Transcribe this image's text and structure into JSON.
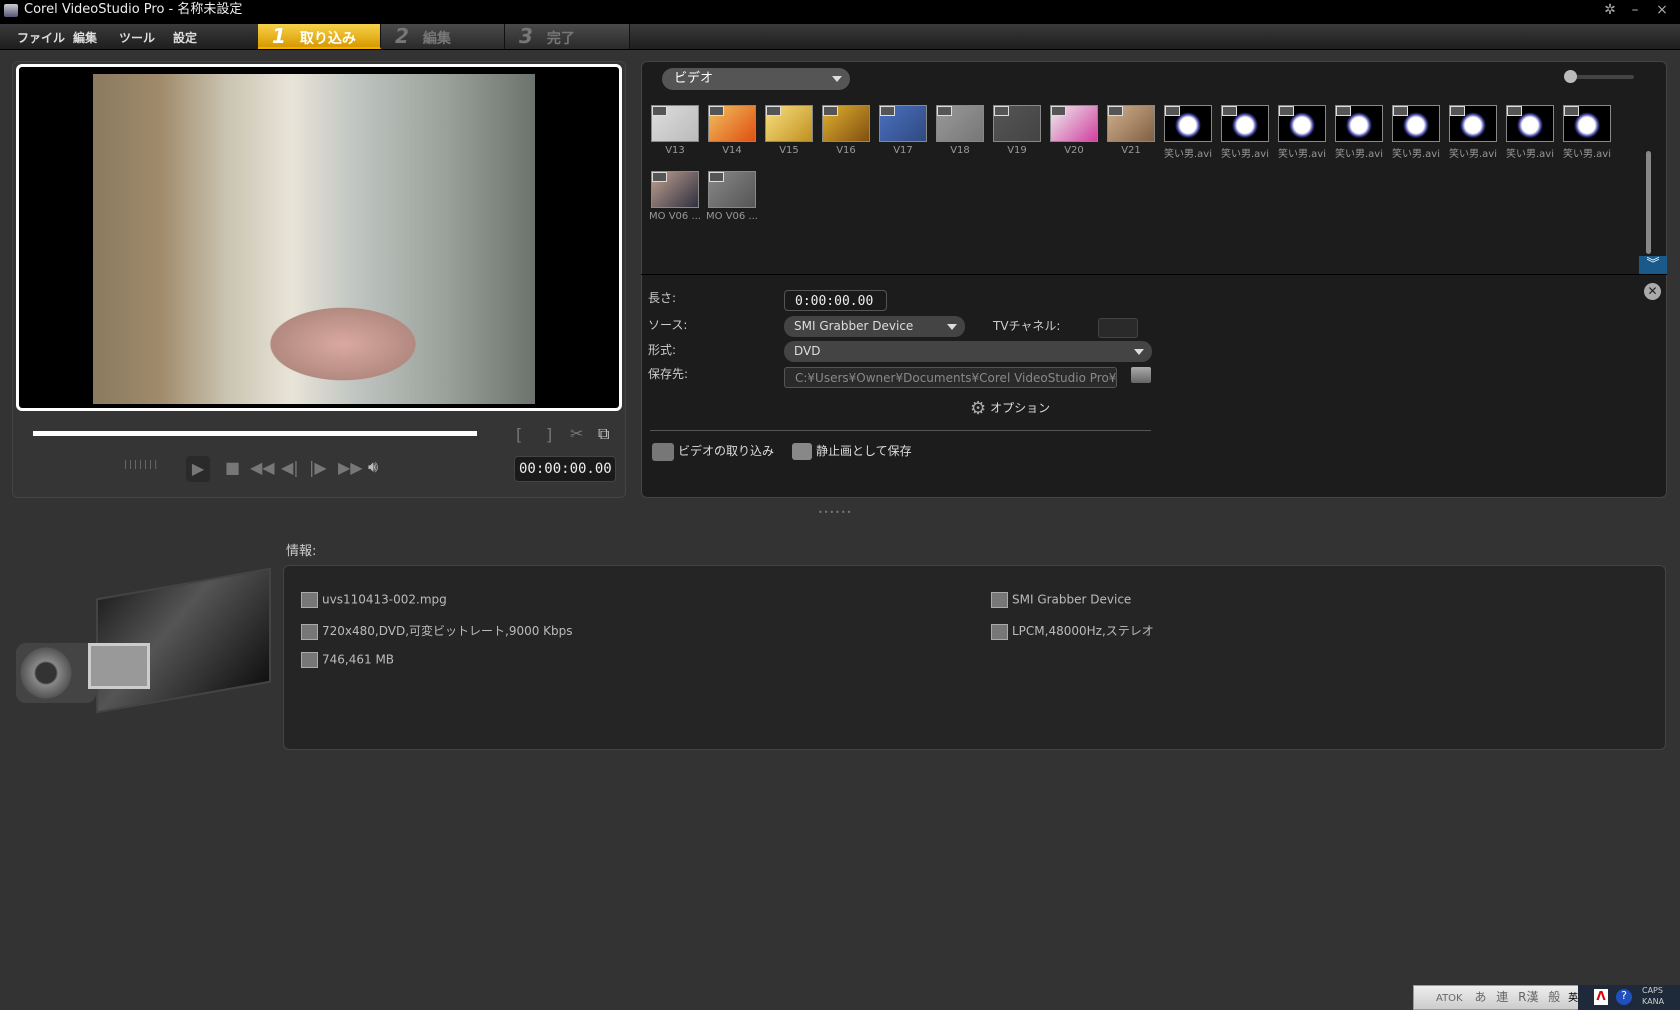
{
  "window": {
    "title": "Corel VideoStudio Pro - 名称未設定",
    "controls": [
      "✲",
      "–",
      "×"
    ]
  },
  "menu": [
    "ファイル",
    "編集",
    "ツール",
    "設定"
  ],
  "steps": [
    {
      "num": "1",
      "label": "取り込み",
      "active": true
    },
    {
      "num": "2",
      "label": "編集",
      "active": false
    },
    {
      "num": "3",
      "label": "完了",
      "active": false
    }
  ],
  "preview": {
    "timecode": "00:00:00.00",
    "trim_in": "[",
    "trim_out": "]"
  },
  "library": {
    "media_type": "ビデオ",
    "thumbnails": [
      {
        "label": "V13",
        "colors": [
          "#ddd",
          "#bbb"
        ]
      },
      {
        "label": "V14",
        "colors": [
          "#f0c060",
          "#e05010"
        ]
      },
      {
        "label": "V15",
        "colors": [
          "#f8e080",
          "#c09020"
        ]
      },
      {
        "label": "V16",
        "colors": [
          "#e0b030",
          "#805010"
        ]
      },
      {
        "label": "V17",
        "colors": [
          "#4a70c0",
          "#304a80"
        ]
      },
      {
        "label": "V18",
        "colors": [
          "#999",
          "#777"
        ]
      },
      {
        "label": "V19",
        "colors": [
          "#555",
          "#444"
        ]
      },
      {
        "label": "V20",
        "colors": [
          "#eee",
          "#d040a0"
        ]
      },
      {
        "label": "V21",
        "colors": [
          "#d0b090",
          "#806040"
        ]
      },
      {
        "label": "笑い男.avi",
        "colors": [
          "#000",
          "#4040a0"
        ]
      },
      {
        "label": "笑い男.avi",
        "colors": [
          "#000",
          "#4040a0"
        ]
      },
      {
        "label": "笑い男.avi",
        "colors": [
          "#000",
          "#4040a0"
        ]
      },
      {
        "label": "笑い男.avi",
        "colors": [
          "#000",
          "#4040a0"
        ]
      },
      {
        "label": "笑い男.avi",
        "colors": [
          "#000",
          "#4040a0"
        ]
      },
      {
        "label": "笑い男.avi",
        "colors": [
          "#000",
          "#4040a0"
        ]
      },
      {
        "label": "笑い男.avi",
        "colors": [
          "#000",
          "#4040a0"
        ]
      },
      {
        "label": "笑い男.avi",
        "colors": [
          "#000",
          "#4040a0"
        ]
      },
      {
        "label": "MO V06 ...",
        "colors": [
          "#c0a090",
          "#303040"
        ]
      },
      {
        "label": "MO V06 ...",
        "colors": [
          "#888",
          "#555"
        ]
      }
    ]
  },
  "capture": {
    "length_label": "長さ:",
    "length_value": "0:00:00.00",
    "source_label": "ソース:",
    "source_value": "SMI Grabber Device",
    "tv_channel_label": "TVチャネル:",
    "format_label": "形式:",
    "format_value": "DVD",
    "save_to_label": "保存先:",
    "save_to_value": "C:¥Users¥Owner¥Documents¥Corel VideoStudio Pro¥Corel",
    "options_label": "オプション",
    "capture_video_label": "ビデオの取り込み",
    "save_still_label": "静止画として保存"
  },
  "info": {
    "label": "情報:",
    "filename": "uvs110413-002.mpg",
    "video_props": "720x480,DVD,可変ビットレート,9000 Kbps",
    "size": "746,461 MB",
    "device": "SMI Grabber Device",
    "audio_props": "LPCM,48000Hz,ステレオ"
  },
  "ime": {
    "items": [
      "ATOK",
      "あ",
      "連",
      "R漢",
      "般",
      "英"
    ],
    "caps": "CAPS",
    "kana": "KANA"
  },
  "colors": {
    "accent": "#f0b000",
    "panel": "#1c1c1c",
    "background": "#333333"
  }
}
